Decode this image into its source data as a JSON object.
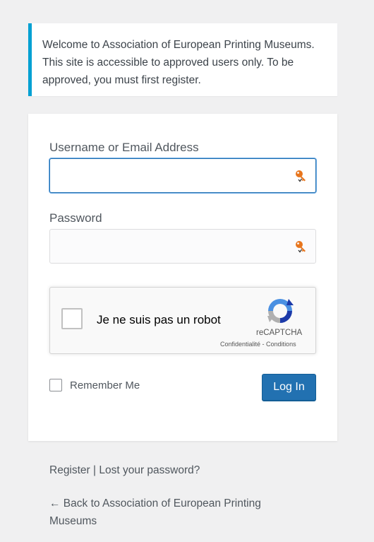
{
  "notice": {
    "text": "Welcome to Association of European Printing Museums. This site is accessible to approved users only. To be approved, you must first register."
  },
  "login_form": {
    "username_label": "Username or Email Address",
    "username_value": "",
    "password_label": "Password",
    "password_value": "",
    "field_icon": "key-icon",
    "recaptcha": {
      "checkbox_label": "Je ne suis pas un robot",
      "brand": "reCAPTCHA",
      "privacy": "Confidentialité",
      "separator": " - ",
      "terms": "Conditions"
    },
    "remember_label": "Remember Me",
    "remember_checked": false,
    "submit_label": "Log In"
  },
  "nav": {
    "register": "Register",
    "separator": " | ",
    "lost_password": "Lost your password?"
  },
  "back_link": "← Back to Association of European Printing Museums",
  "colors": {
    "accent": "#00a0d2",
    "button": "#2271b1",
    "key_icon": "#e8761e"
  }
}
